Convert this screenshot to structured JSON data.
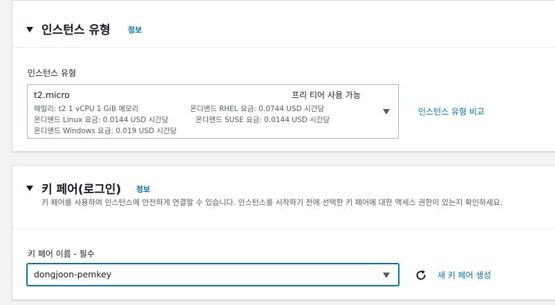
{
  "instance_type_section": {
    "title": "인스턴스 유형",
    "info_link": "정보",
    "field_label": "인스턴스 유형",
    "selected": {
      "name": "t2.micro",
      "badge": "프리 티어 사용 가능",
      "line1": "패밀리: t2    1 vCPU    1 GiB 메모리",
      "line1b": "온디맨드 RHEL 요금: 0.0744 USD 시간당",
      "line2": "온디맨드 Linux 요금: 0.0144 USD 시간당",
      "line2b": "온디맨드 SUSE 요금: 0.0144 USD 시간당",
      "line3": "온디맨드 Windows 요금: 0.019 USD 시간당"
    },
    "compare_link": "인스턴스 유형 비교"
  },
  "key_pair_section": {
    "title": "키 페어(로그인)",
    "info_link": "정보",
    "description": "키 페어를 사용하여 인스턴스에 안전하게 연결할 수 있습니다. 인스턴스를 시작하기 전에 선택한 키 페어에 대한 액세스 권한이 있는지 확인하세요.",
    "field_label": "키 페어 이름 - 필수",
    "selected_value": "dongjoon-pemkey",
    "create_link": "새 키 페어 생성"
  },
  "colors": {
    "link": "#0073bb",
    "focus_border": "#0073bb",
    "background": "#f2f3f3"
  },
  "icons": [
    "caret-down-icon",
    "refresh-icon"
  ]
}
